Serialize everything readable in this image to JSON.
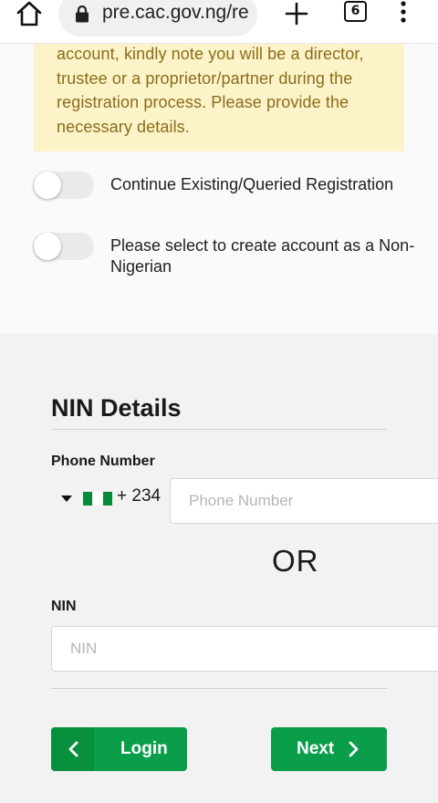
{
  "browser": {
    "url": "pre.cac.gov.ng/re",
    "tab_count": "6",
    "icons": [
      "home-icon",
      "lock-icon",
      "plus-icon",
      "tab-switcher-icon",
      "more-vertical-icon"
    ]
  },
  "notice": {
    "text": "account, kindly note you will be a director, trustee or a proprietor/partner during the registration process. Please provide the necessary details."
  },
  "toggles": [
    {
      "label": "Continue Existing/Queried Registration",
      "checked": false
    },
    {
      "label": "Please select to create account as a Non-Nigerian",
      "checked": false
    }
  ],
  "nin_section": {
    "title": "NIN Details",
    "phone_label": "Phone Number",
    "dial_code": "+ 234",
    "phone_placeholder": "Phone Number",
    "or_text": "OR",
    "nin_label": "NIN",
    "nin_placeholder": "NIN"
  },
  "buttons": {
    "login_label": "Login",
    "next_label": "Next"
  },
  "colors": {
    "primary_green": "#0a9e4a",
    "notice_bg": "#fcf3c8",
    "notice_text": "#8a6d1c"
  }
}
